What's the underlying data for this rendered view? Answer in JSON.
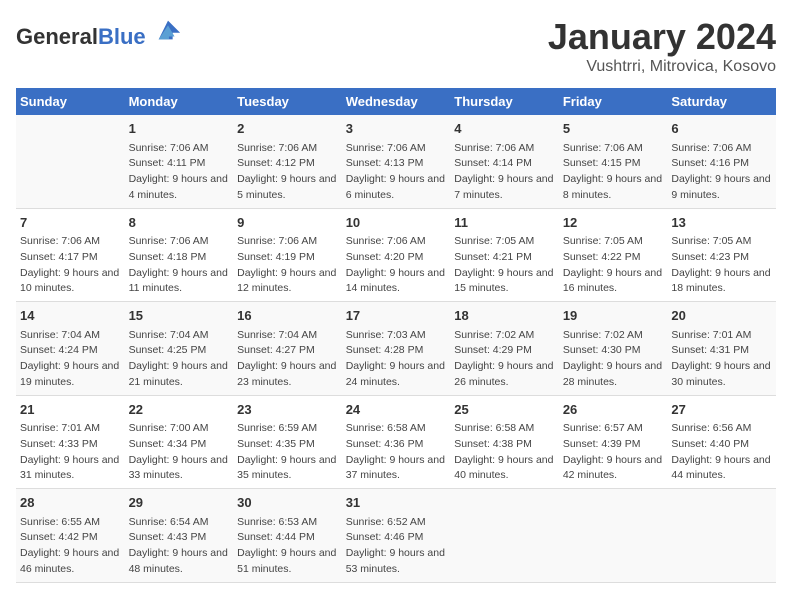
{
  "header": {
    "logo_general": "General",
    "logo_blue": "Blue",
    "main_title": "January 2024",
    "subtitle": "Vushtrri, Mitrovica, Kosovo"
  },
  "columns": [
    "Sunday",
    "Monday",
    "Tuesday",
    "Wednesday",
    "Thursday",
    "Friday",
    "Saturday"
  ],
  "weeks": [
    [
      {
        "day": "",
        "sunrise": "",
        "sunset": "",
        "daylight": ""
      },
      {
        "day": "1",
        "sunrise": "Sunrise: 7:06 AM",
        "sunset": "Sunset: 4:11 PM",
        "daylight": "Daylight: 9 hours and 4 minutes."
      },
      {
        "day": "2",
        "sunrise": "Sunrise: 7:06 AM",
        "sunset": "Sunset: 4:12 PM",
        "daylight": "Daylight: 9 hours and 5 minutes."
      },
      {
        "day": "3",
        "sunrise": "Sunrise: 7:06 AM",
        "sunset": "Sunset: 4:13 PM",
        "daylight": "Daylight: 9 hours and 6 minutes."
      },
      {
        "day": "4",
        "sunrise": "Sunrise: 7:06 AM",
        "sunset": "Sunset: 4:14 PM",
        "daylight": "Daylight: 9 hours and 7 minutes."
      },
      {
        "day": "5",
        "sunrise": "Sunrise: 7:06 AM",
        "sunset": "Sunset: 4:15 PM",
        "daylight": "Daylight: 9 hours and 8 minutes."
      },
      {
        "day": "6",
        "sunrise": "Sunrise: 7:06 AM",
        "sunset": "Sunset: 4:16 PM",
        "daylight": "Daylight: 9 hours and 9 minutes."
      }
    ],
    [
      {
        "day": "7",
        "sunrise": "Sunrise: 7:06 AM",
        "sunset": "Sunset: 4:17 PM",
        "daylight": "Daylight: 9 hours and 10 minutes."
      },
      {
        "day": "8",
        "sunrise": "Sunrise: 7:06 AM",
        "sunset": "Sunset: 4:18 PM",
        "daylight": "Daylight: 9 hours and 11 minutes."
      },
      {
        "day": "9",
        "sunrise": "Sunrise: 7:06 AM",
        "sunset": "Sunset: 4:19 PM",
        "daylight": "Daylight: 9 hours and 12 minutes."
      },
      {
        "day": "10",
        "sunrise": "Sunrise: 7:06 AM",
        "sunset": "Sunset: 4:20 PM",
        "daylight": "Daylight: 9 hours and 14 minutes."
      },
      {
        "day": "11",
        "sunrise": "Sunrise: 7:05 AM",
        "sunset": "Sunset: 4:21 PM",
        "daylight": "Daylight: 9 hours and 15 minutes."
      },
      {
        "day": "12",
        "sunrise": "Sunrise: 7:05 AM",
        "sunset": "Sunset: 4:22 PM",
        "daylight": "Daylight: 9 hours and 16 minutes."
      },
      {
        "day": "13",
        "sunrise": "Sunrise: 7:05 AM",
        "sunset": "Sunset: 4:23 PM",
        "daylight": "Daylight: 9 hours and 18 minutes."
      }
    ],
    [
      {
        "day": "14",
        "sunrise": "Sunrise: 7:04 AM",
        "sunset": "Sunset: 4:24 PM",
        "daylight": "Daylight: 9 hours and 19 minutes."
      },
      {
        "day": "15",
        "sunrise": "Sunrise: 7:04 AM",
        "sunset": "Sunset: 4:25 PM",
        "daylight": "Daylight: 9 hours and 21 minutes."
      },
      {
        "day": "16",
        "sunrise": "Sunrise: 7:04 AM",
        "sunset": "Sunset: 4:27 PM",
        "daylight": "Daylight: 9 hours and 23 minutes."
      },
      {
        "day": "17",
        "sunrise": "Sunrise: 7:03 AM",
        "sunset": "Sunset: 4:28 PM",
        "daylight": "Daylight: 9 hours and 24 minutes."
      },
      {
        "day": "18",
        "sunrise": "Sunrise: 7:02 AM",
        "sunset": "Sunset: 4:29 PM",
        "daylight": "Daylight: 9 hours and 26 minutes."
      },
      {
        "day": "19",
        "sunrise": "Sunrise: 7:02 AM",
        "sunset": "Sunset: 4:30 PM",
        "daylight": "Daylight: 9 hours and 28 minutes."
      },
      {
        "day": "20",
        "sunrise": "Sunrise: 7:01 AM",
        "sunset": "Sunset: 4:31 PM",
        "daylight": "Daylight: 9 hours and 30 minutes."
      }
    ],
    [
      {
        "day": "21",
        "sunrise": "Sunrise: 7:01 AM",
        "sunset": "Sunset: 4:33 PM",
        "daylight": "Daylight: 9 hours and 31 minutes."
      },
      {
        "day": "22",
        "sunrise": "Sunrise: 7:00 AM",
        "sunset": "Sunset: 4:34 PM",
        "daylight": "Daylight: 9 hours and 33 minutes."
      },
      {
        "day": "23",
        "sunrise": "Sunrise: 6:59 AM",
        "sunset": "Sunset: 4:35 PM",
        "daylight": "Daylight: 9 hours and 35 minutes."
      },
      {
        "day": "24",
        "sunrise": "Sunrise: 6:58 AM",
        "sunset": "Sunset: 4:36 PM",
        "daylight": "Daylight: 9 hours and 37 minutes."
      },
      {
        "day": "25",
        "sunrise": "Sunrise: 6:58 AM",
        "sunset": "Sunset: 4:38 PM",
        "daylight": "Daylight: 9 hours and 40 minutes."
      },
      {
        "day": "26",
        "sunrise": "Sunrise: 6:57 AM",
        "sunset": "Sunset: 4:39 PM",
        "daylight": "Daylight: 9 hours and 42 minutes."
      },
      {
        "day": "27",
        "sunrise": "Sunrise: 6:56 AM",
        "sunset": "Sunset: 4:40 PM",
        "daylight": "Daylight: 9 hours and 44 minutes."
      }
    ],
    [
      {
        "day": "28",
        "sunrise": "Sunrise: 6:55 AM",
        "sunset": "Sunset: 4:42 PM",
        "daylight": "Daylight: 9 hours and 46 minutes."
      },
      {
        "day": "29",
        "sunrise": "Sunrise: 6:54 AM",
        "sunset": "Sunset: 4:43 PM",
        "daylight": "Daylight: 9 hours and 48 minutes."
      },
      {
        "day": "30",
        "sunrise": "Sunrise: 6:53 AM",
        "sunset": "Sunset: 4:44 PM",
        "daylight": "Daylight: 9 hours and 51 minutes."
      },
      {
        "day": "31",
        "sunrise": "Sunrise: 6:52 AM",
        "sunset": "Sunset: 4:46 PM",
        "daylight": "Daylight: 9 hours and 53 minutes."
      },
      {
        "day": "",
        "sunrise": "",
        "sunset": "",
        "daylight": ""
      },
      {
        "day": "",
        "sunrise": "",
        "sunset": "",
        "daylight": ""
      },
      {
        "day": "",
        "sunrise": "",
        "sunset": "",
        "daylight": ""
      }
    ]
  ]
}
